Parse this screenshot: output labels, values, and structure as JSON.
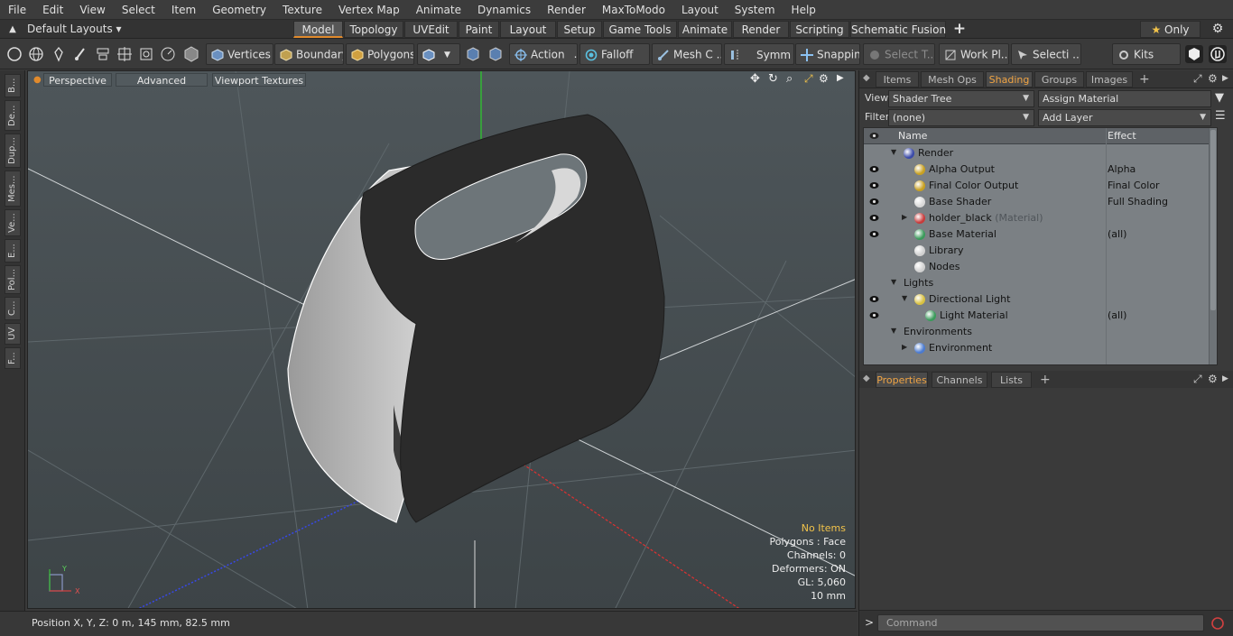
{
  "menu": [
    "File",
    "Edit",
    "View",
    "Select",
    "Item",
    "Geometry",
    "Texture",
    "Vertex Map",
    "Animate",
    "Dynamics",
    "Render",
    "MaxToModo",
    "Layout",
    "System",
    "Help"
  ],
  "layoutbar": {
    "layout_select": "Default Layouts",
    "tabs": [
      "Model",
      "Topology",
      "UVEdit",
      "Paint",
      "Layout",
      "Setup",
      "Game Tools",
      "Animate",
      "Render",
      "Scripting",
      "Schematic Fusion"
    ],
    "active_tab": "Model",
    "add_label": "+",
    "only_label": "Only"
  },
  "toolbar": {
    "vertices": "Vertices",
    "boundary": "Boundary",
    "polygons": "Polygons",
    "action": "Action",
    "falloff": "Falloff",
    "meshc": "Mesh C ...",
    "symm": "Symm ...",
    "snapping": "Snapping",
    "selectt": "Select T...",
    "workpl": "Work Pl...",
    "selecti": "Selecti ...",
    "kits": "Kits"
  },
  "lefttabs": [
    "B...",
    "De...",
    "Dup...",
    "Mes...",
    "Ve...",
    "E...",
    "Pol...",
    "C...",
    "UV",
    "F..."
  ],
  "viewport": {
    "view_mode": "Perspective",
    "advanced": "Advanced",
    "viewport_textures": "Viewport Textures",
    "info": {
      "no_items": "No Items",
      "polygons": "Polygons : Face",
      "channels": "Channels: 0",
      "deformers": "Deformers: ON",
      "gl": "GL: 5,060",
      "scale": "10 mm"
    },
    "axis_y": "Y",
    "axis_x": "X"
  },
  "status": "Position X, Y, Z:   0 m, 145 mm, 82.5 mm",
  "panel": {
    "tabs": [
      "Items",
      "Mesh Ops",
      "Shading",
      "Groups",
      "Images"
    ],
    "active_tab": "Shading",
    "view_label": "View",
    "view_value": "Shader Tree",
    "assign_material": "Assign Material",
    "filter_label": "Filter",
    "filter_value": "(none)",
    "add_layer": "Add Layer",
    "col_name": "Name",
    "col_effect": "Effect",
    "tree": [
      {
        "name": "Render",
        "sub": "",
        "effect": "",
        "depth": 0,
        "icon": "#3a4aa8",
        "eye": false,
        "exp": "▼"
      },
      {
        "name": "Alpha Output",
        "sub": "",
        "effect": "Alpha",
        "depth": 1,
        "icon": "#c8a020",
        "eye": true,
        "exp": ""
      },
      {
        "name": "Final Color Output",
        "sub": "",
        "effect": "Final Color",
        "depth": 1,
        "icon": "#c8a020",
        "eye": true,
        "exp": ""
      },
      {
        "name": "Base Shader",
        "sub": "",
        "effect": "Full Shading",
        "depth": 1,
        "icon": "#d8d8d8",
        "eye": true,
        "exp": ""
      },
      {
        "name": "holder_black",
        "sub": " (Material)",
        "effect": "",
        "depth": 1,
        "icon": "#c83a3a",
        "eye": true,
        "exp": "▶"
      },
      {
        "name": "Base Material",
        "sub": "",
        "effect": "(all)",
        "depth": 1,
        "icon": "#3a9a5a",
        "eye": true,
        "exp": ""
      },
      {
        "name": "Library",
        "sub": "",
        "effect": "",
        "depth": 1,
        "icon": "#d0d0d0",
        "eye": false,
        "exp": ""
      },
      {
        "name": "Nodes",
        "sub": "",
        "effect": "",
        "depth": 1,
        "icon": "#d0d0d0",
        "eye": false,
        "exp": ""
      },
      {
        "name": "Lights",
        "sub": "",
        "effect": "",
        "depth": 0,
        "icon": "",
        "eye": false,
        "exp": "▼"
      },
      {
        "name": "Directional Light",
        "sub": "",
        "effect": "",
        "depth": 1,
        "icon": "#d8c040",
        "eye": true,
        "exp": "▼"
      },
      {
        "name": "Light Material",
        "sub": "",
        "effect": "(all)",
        "depth": 2,
        "icon": "#3a9a5a",
        "eye": true,
        "exp": ""
      },
      {
        "name": "Environments",
        "sub": "",
        "effect": "",
        "depth": 0,
        "icon": "",
        "eye": false,
        "exp": "▼"
      },
      {
        "name": "Environment",
        "sub": "",
        "effect": "",
        "depth": 1,
        "icon": "#4a7ad0",
        "eye": false,
        "exp": "▶"
      }
    ],
    "lower_tabs": [
      "Properties",
      "Channels",
      "Lists"
    ],
    "lower_active": "Properties",
    "command_placeholder": "Command",
    "prompt": ">"
  },
  "colors": {
    "accent": "#e08a2c",
    "highlight": "#f2c34a"
  }
}
